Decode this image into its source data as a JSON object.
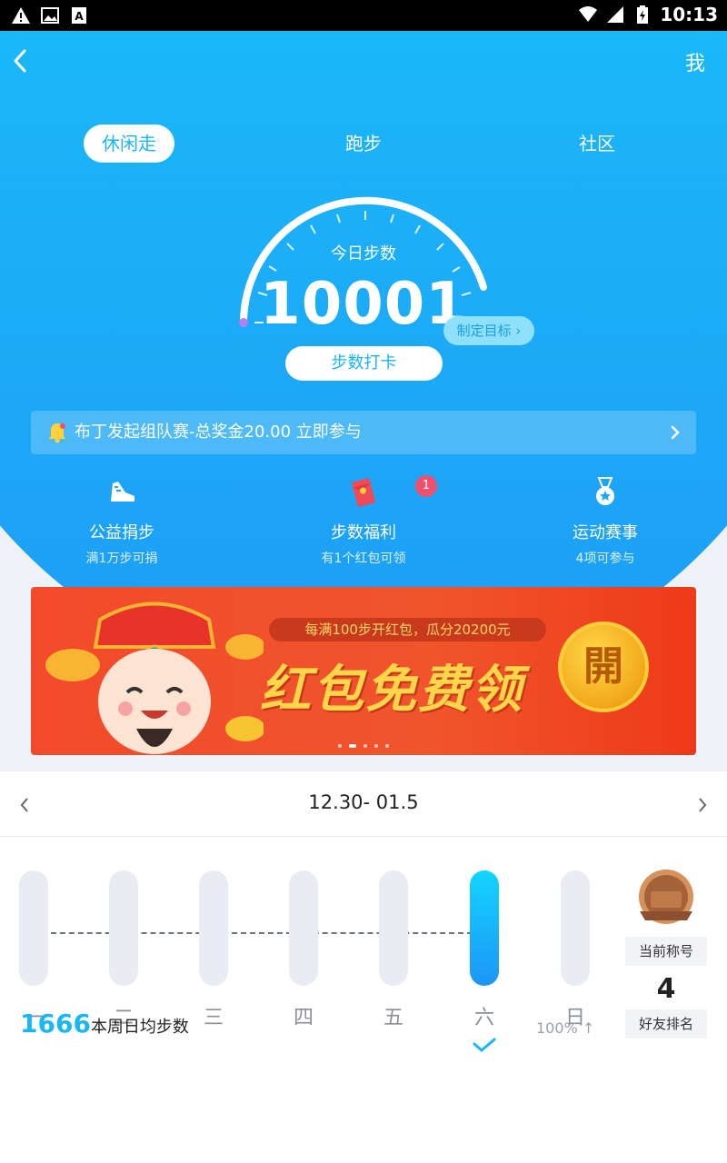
{
  "status_bar": {
    "time": "10:13"
  },
  "header": {
    "right_label": "我"
  },
  "tabs": [
    {
      "label": "休闲走",
      "active": true
    },
    {
      "label": "跑步"
    },
    {
      "label": "社区"
    }
  ],
  "gauge": {
    "label": "今日步数",
    "value": "10001",
    "goal_button": "制定目标",
    "checkin_button": "步数打卡"
  },
  "notice": {
    "text": "布丁发起组队赛-总奖金20.00 立即参与"
  },
  "features": [
    {
      "icon": "shoe-icon",
      "title": "公益捐步",
      "subtitle": "满1万步可捐"
    },
    {
      "icon": "red-envelope-icon",
      "title": "步数福利",
      "subtitle": "有1个红包可领",
      "badge": "1"
    },
    {
      "icon": "medal-icon",
      "title": "运动赛事",
      "subtitle": "4项可参与"
    }
  ],
  "banner": {
    "promo": "每满100步开红包，瓜分20200元",
    "title": "红包免费领",
    "coin_text": "開"
  },
  "week": {
    "range": "12.30- 01.5",
    "days": [
      "一",
      "二",
      "三",
      "四",
      "五",
      "六",
      "日"
    ],
    "progress": [
      0,
      0,
      0,
      0,
      0,
      1,
      0
    ],
    "average_value": "1666",
    "average_label": "本周日均步数",
    "percent": "100%"
  },
  "ranking": {
    "title_label": "当前称号",
    "rank_value": "4",
    "rank_label": "好友排名"
  },
  "colors": {
    "primary": "#18b4f5",
    "badge": "#f0506e",
    "banner": "#f24a2b"
  }
}
